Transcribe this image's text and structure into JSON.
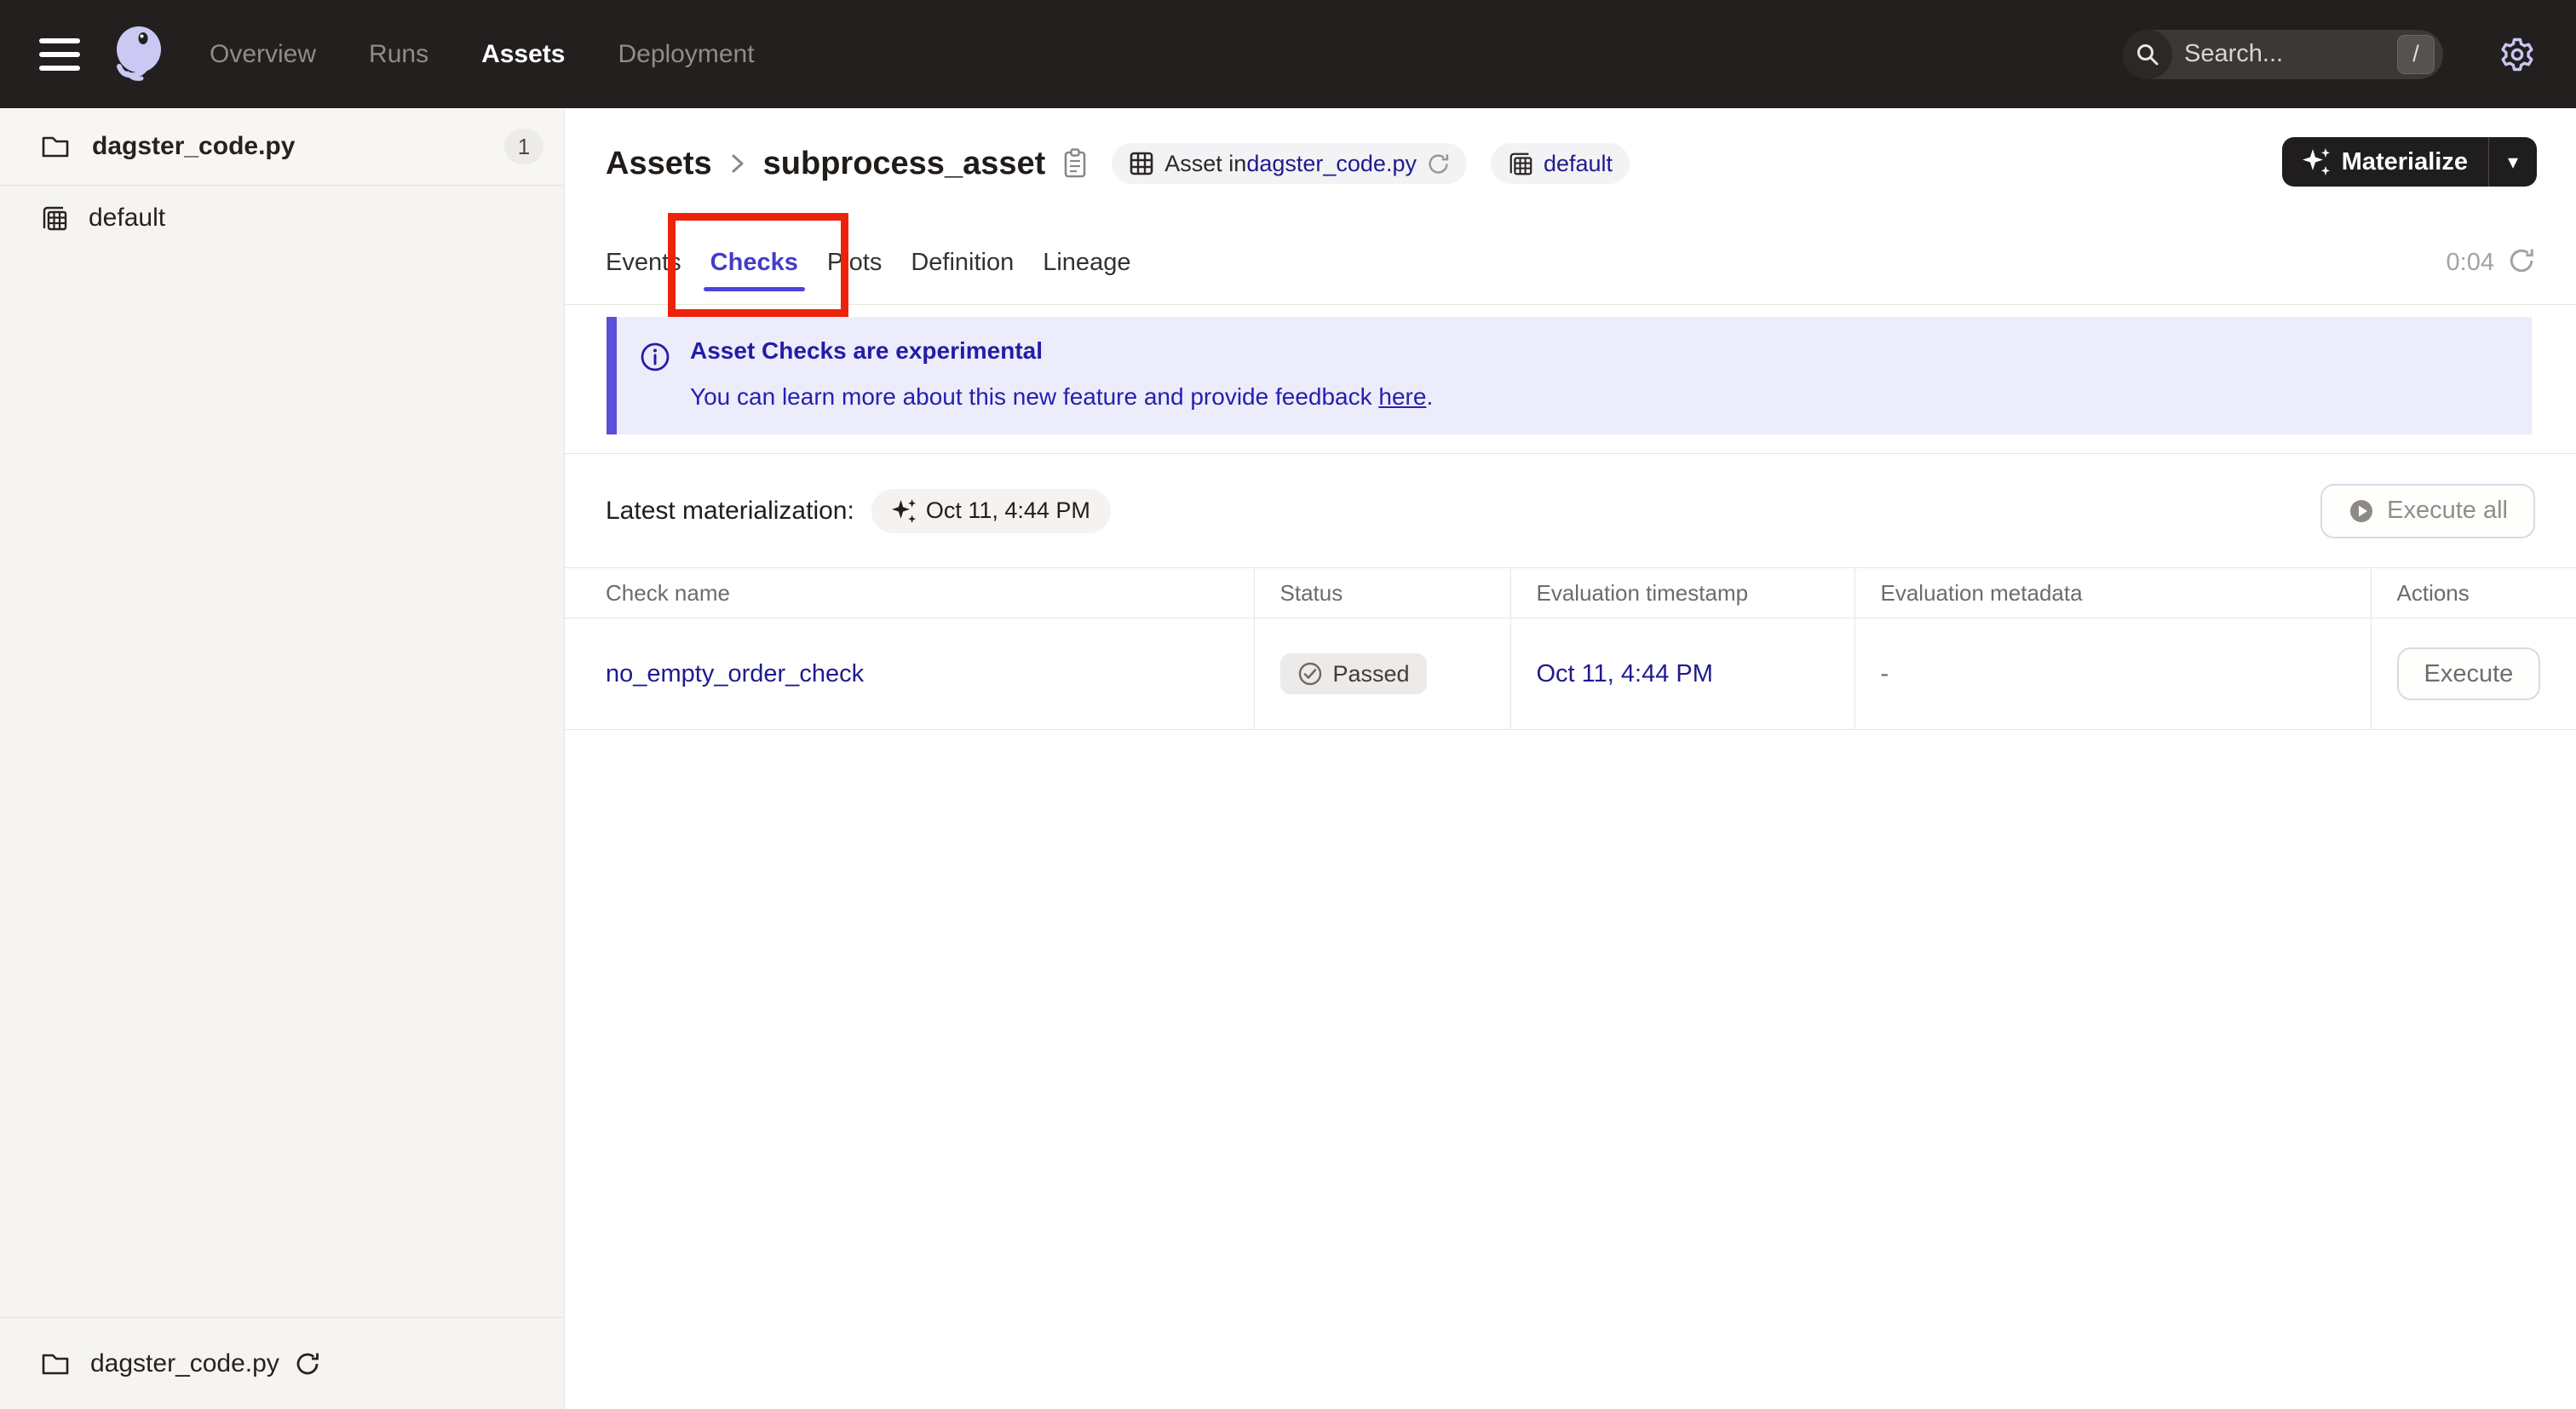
{
  "nav": {
    "items": [
      {
        "label": "Overview",
        "active": false
      },
      {
        "label": "Runs",
        "active": false
      },
      {
        "label": "Assets",
        "active": true
      },
      {
        "label": "Deployment",
        "active": false
      }
    ],
    "search": {
      "placeholder": "Search...",
      "shortcut": "/"
    }
  },
  "sidebar": {
    "code_location": {
      "label": "dagster_code.py",
      "badge": "1"
    },
    "group": {
      "label": "default"
    },
    "footer": {
      "label": "dagster_code.py"
    }
  },
  "header": {
    "breadcrumb": {
      "root": "Assets",
      "current": "subprocess_asset"
    },
    "asset_pill": {
      "prefix": "Asset in ",
      "link": "dagster_code.py"
    },
    "group_pill": {
      "link": "default"
    },
    "materialize": {
      "label": "Materialize"
    }
  },
  "tabs": {
    "items": [
      {
        "label": "Events",
        "active": false
      },
      {
        "label": "Checks",
        "active": true
      },
      {
        "label": "Plots",
        "active": false
      },
      {
        "label": "Definition",
        "active": false
      },
      {
        "label": "Lineage",
        "active": false
      }
    ],
    "timer": "0:04"
  },
  "banner": {
    "title": "Asset Checks are experimental",
    "body": "You can learn more about this new feature and provide feedback ",
    "link": "here",
    "after_link": "."
  },
  "materializations": {
    "label": "Latest materialization:",
    "timestamp": "Oct 11, 4:44 PM",
    "execute_all": "Execute all"
  },
  "table": {
    "columns": [
      "Check name",
      "Status",
      "Evaluation timestamp",
      "Evaluation metadata",
      "Actions"
    ],
    "row": {
      "name": "no_empty_order_check",
      "status": "Passed",
      "timestamp": "Oct 11, 4:44 PM",
      "metadata": "-",
      "action": "Execute"
    }
  },
  "colors": {
    "accent": "#4F43DD",
    "link": "#1F1B8C",
    "nav_bg": "#221F1E",
    "banner_bg": "#EDECFA",
    "banner_text": "#221DA8",
    "status_badge_bg": "#ECEBE9",
    "annotation": "#EC2309"
  }
}
